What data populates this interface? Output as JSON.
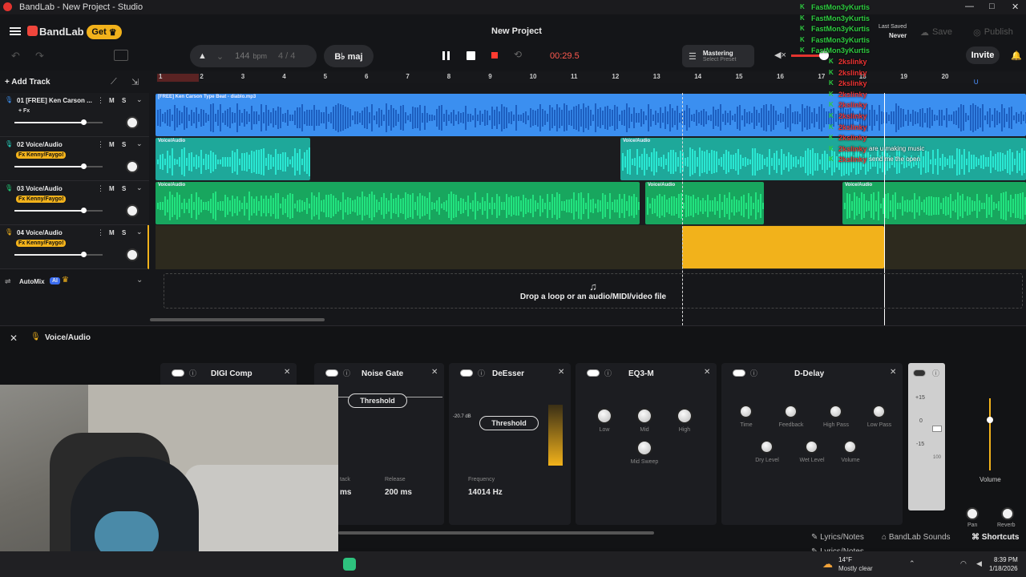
{
  "window": {
    "title": "BandLab - New Project - Studio",
    "controls": [
      "—",
      "□",
      "✕"
    ]
  },
  "header": {
    "brand": "BandLab",
    "get_label": "Get",
    "project_title": "New Project",
    "bpm_value": "144",
    "bpm_unit": "bpm",
    "time_sig": "4 / 4",
    "key": "B♭ maj",
    "time_display": "00:29.5",
    "mastering_label": "Mastering",
    "mastering_sub": "Select Preset",
    "last_saved_label": "Last Saved",
    "last_saved_value": "Never",
    "save_label": "Save",
    "publish_label": "Publish",
    "invite_label": "Invite"
  },
  "sidebar": {
    "add_track": "Add Track",
    "automix": "AutoMix",
    "ai_badge": "AI"
  },
  "ruler": [
    "1",
    "2",
    "3",
    "4",
    "5",
    "6",
    "7",
    "8",
    "9",
    "10",
    "11",
    "12",
    "13",
    "14",
    "15",
    "16",
    "17",
    "18",
    "19",
    "20"
  ],
  "tracks": [
    {
      "name": "01  [FREE] Ken Carson ...",
      "fx": "+ Fx",
      "m": "M",
      "s": "S"
    },
    {
      "name": "02  Voice/Audio",
      "fx": "Fx Kenny/Faygo!",
      "m": "M",
      "s": "S"
    },
    {
      "name": "03  Voice/Audio",
      "fx": "Fx Kenny/Faygo!",
      "m": "M",
      "s": "S"
    },
    {
      "name": "04  Voice/Audio",
      "fx": "Fx Kenny/Faygo!",
      "m": "M",
      "s": "S"
    }
  ],
  "clips": {
    "beat": "[FREE] Ken Carson Type Beat - diablo.mp3",
    "voice": "Voice/Audio"
  },
  "drop_hint": "Drop a loop or an audio/MIDI/video file",
  "fx_panel": {
    "title": "Voice/Audio",
    "plugins": [
      {
        "name": "DIGI Comp"
      },
      {
        "name": "Noise Gate",
        "param": "Threshold",
        "release_label": "Release",
        "release_value": "200 ms",
        "attack_label": "tack",
        "attack_value": "ms"
      },
      {
        "name": "DeEsser",
        "param": "Threshold",
        "db": "-20.7 dB",
        "freq_label": "Frequency",
        "freq_value": "14014 Hz"
      },
      {
        "name": "EQ3-M",
        "knobs": [
          "Low",
          "Mid",
          "High",
          "Mid Sweep"
        ]
      },
      {
        "name": "D-Delay",
        "knobs": [
          "Time",
          "Feedback",
          "High Pass",
          "Low Pass",
          "Dry Level",
          "Wet Level",
          "Volume"
        ]
      }
    ],
    "scale": [
      "+15",
      "0",
      "-15",
      "100"
    ],
    "volume_label": "Volume",
    "pan_label": "Pan",
    "reverb_label": "Reverb"
  },
  "footer": {
    "lyrics": "Lyrics/Notes",
    "sounds": "BandLab Sounds",
    "shortcuts": "Shortcuts"
  },
  "chat": {
    "lines": [
      {
        "user": "FastMon3yKurtis",
        "msg": ""
      },
      {
        "user": "FastMon3yKurtis",
        "msg": ""
      },
      {
        "user": "FastMon3yKurtis",
        "msg": ""
      },
      {
        "user": "FastMon3yKurtis",
        "msg": ""
      },
      {
        "user": "FastMon3yKurtis",
        "msg": ""
      },
      {
        "user": "2kslinky",
        "msg": ""
      },
      {
        "user": "2kslinky",
        "msg": ""
      },
      {
        "user": "2kslinky",
        "msg": ""
      },
      {
        "user": "2kslinky",
        "msg": ""
      },
      {
        "user": "2kslinky",
        "msg": ""
      },
      {
        "user": "2kslinky",
        "msg": ""
      },
      {
        "user": "2kslinky",
        "msg": ""
      },
      {
        "user": "2kslinky",
        "msg": ""
      },
      {
        "user": "2kslinky",
        "msg": "are u making music"
      },
      {
        "user": "2kslinky",
        "msg": "send me the open"
      }
    ]
  },
  "taskbar": {
    "temp": "14°F",
    "weather": "Mostly clear",
    "time": "8:39 PM",
    "date": "1/18/2026"
  },
  "colors": {
    "accent": "#f2b21b",
    "beat": "#3b8ff0",
    "teal": "#25d9c4",
    "green": "#1fd67a",
    "record": "#ff3b30",
    "timer": "#ff5a4f"
  }
}
